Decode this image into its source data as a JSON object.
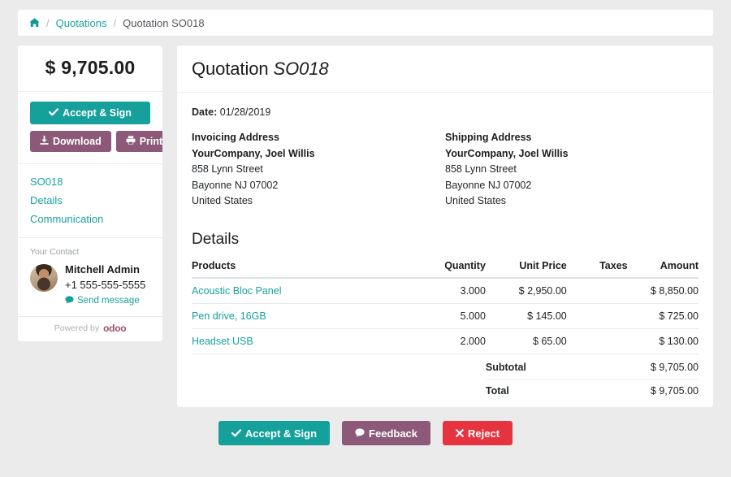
{
  "breadcrumb": {
    "home_icon": "home-icon",
    "separator": "/",
    "parent_label": "Quotations",
    "current_label": "Quotation SO018"
  },
  "sidebar": {
    "amount_total": "$ 9,705.00",
    "accept_button": "Accept & Sign",
    "accept_icon": "check-icon",
    "download_button": "Download",
    "download_icon": "download-icon",
    "print_button": "Print",
    "print_icon": "printer-icon",
    "nav_links": [
      {
        "label": "SO018"
      },
      {
        "label": "Details"
      },
      {
        "label": "Communication"
      }
    ],
    "contact": {
      "section_label": "Your Contact",
      "avatar_icon": "avatar-photo",
      "name": "Mitchell Admin",
      "phone": "+1 555-555-5555",
      "send_message_label": "Send message",
      "send_message_icon": "comment-icon"
    },
    "powered_by_text": "Powered by",
    "powered_by_brand": "odoo"
  },
  "main": {
    "title_prefix": "Quotation",
    "title_document": "SO018",
    "date_label": "Date:",
    "date_value": "01/28/2019",
    "invoicing": {
      "title": "Invoicing Address",
      "company": "YourCompany, Joel Willis",
      "street": "858 Lynn Street",
      "city": "Bayonne NJ 07002",
      "country": "United States"
    },
    "shipping": {
      "title": "Shipping Address",
      "company": "YourCompany, Joel Willis",
      "street": "858 Lynn Street",
      "city": "Bayonne NJ 07002",
      "country": "United States"
    },
    "details_title": "Details",
    "table": {
      "headers": {
        "products": "Products",
        "quantity": "Quantity",
        "unit_price": "Unit Price",
        "taxes": "Taxes",
        "amount": "Amount"
      },
      "rows": [
        {
          "product": "Acoustic Bloc Panel",
          "quantity": "3.000",
          "unit_price": "$ 2,950.00",
          "taxes": "",
          "amount": "$ 8,850.00"
        },
        {
          "product": "Pen drive, 16GB",
          "quantity": "5.000",
          "unit_price": "$ 145.00",
          "taxes": "",
          "amount": "$ 725.00"
        },
        {
          "product": "Headset USB",
          "quantity": "2.000",
          "unit_price": "$ 65.00",
          "taxes": "",
          "amount": "$ 130.00"
        }
      ]
    },
    "totals": {
      "subtotal_label": "Subtotal",
      "subtotal_value": "$ 9,705.00",
      "total_label": "Total",
      "total_value": "$ 9,705.00"
    }
  },
  "footer": {
    "accept_label": "Accept & Sign",
    "accept_icon": "check-icon",
    "feedback_label": "Feedback",
    "feedback_icon": "comment-icon",
    "reject_label": "Reject",
    "reject_icon": "times-icon"
  },
  "colors": {
    "page_background": "#ebebeb",
    "card_background": "#ffffff",
    "accent_teal": "#16a09b",
    "link_teal": "#17a2a0",
    "purple": "#8c5a78",
    "red": "#e5343f",
    "brand_odoo": "#9f4d6e"
  }
}
